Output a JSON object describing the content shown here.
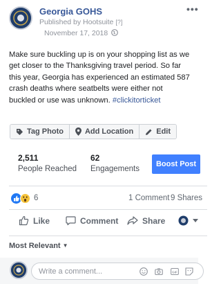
{
  "post": {
    "page_name": "Georgia GOHS",
    "publisher": "Published by Hootsuite",
    "publisher_help": "[?]",
    "date": "November 17, 2018",
    "privacy_icon": "globe-icon",
    "more_icon": "•••",
    "text_lines": [
      "Make sure buckling up is on your shopping list as we",
      "get closer to the Thanksgiving travel period. So far",
      "this year, Georgia has experienced an estimated 587",
      "crash deaths where seatbelts were either not",
      "buckled or use was unknown. "
    ],
    "hashtag": "#clickitorticket"
  },
  "actions": {
    "tag_photo": "Tag Photo",
    "add_location": "Add Location",
    "edit": "Edit"
  },
  "stats": {
    "reached_value": "2,511",
    "reached_label": "People Reached",
    "engagements_value": "62",
    "engagements_label": "Engagements",
    "boost_label": "Boost Post"
  },
  "reactions": {
    "types": [
      "like-icon",
      "wow-icon"
    ],
    "count": "6",
    "comments": "1 Comment",
    "shares": "9 Shares"
  },
  "engage": {
    "like": "Like",
    "comment": "Comment",
    "share": "Share"
  },
  "comments": {
    "sort_label": "Most Relevant",
    "placeholder": "Write a comment..."
  },
  "colors": {
    "link_blue": "#385898",
    "boost_blue": "#4080ff",
    "muted": "#90949c"
  }
}
